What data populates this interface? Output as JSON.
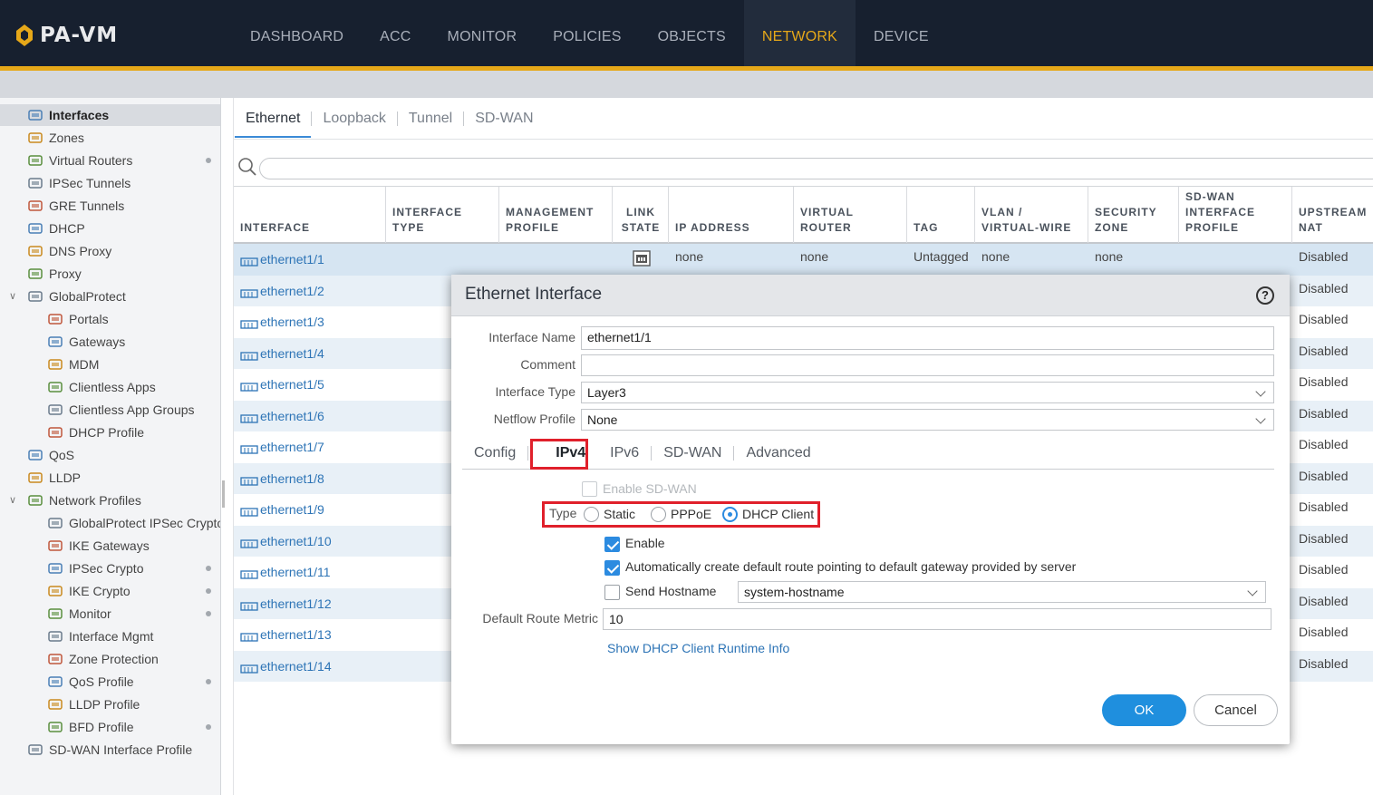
{
  "app": {
    "logo_text": "PA-VM"
  },
  "nav": [
    "DASHBOARD",
    "ACC",
    "MONITOR",
    "POLICIES",
    "OBJECTS",
    "NETWORK",
    "DEVICE"
  ],
  "nav_active": "NETWORK",
  "sidebar": [
    {
      "label": "Interfaces",
      "icon": "interfaces-icon",
      "active": true
    },
    {
      "label": "Zones",
      "icon": "zones-icon"
    },
    {
      "label": "Virtual Routers",
      "icon": "virtual-router-icon",
      "dot": true
    },
    {
      "label": "IPSec Tunnels",
      "icon": "ipsec-tunnel-icon"
    },
    {
      "label": "GRE Tunnels",
      "icon": "gre-tunnel-icon"
    },
    {
      "label": "DHCP",
      "icon": "dhcp-icon"
    },
    {
      "label": "DNS Proxy",
      "icon": "dns-proxy-icon"
    },
    {
      "label": "Proxy",
      "icon": "proxy-icon"
    },
    {
      "label": "GlobalProtect",
      "icon": "globalprotect-icon",
      "expandable": true
    },
    {
      "label": "Portals",
      "icon": "portals-icon",
      "indent": true
    },
    {
      "label": "Gateways",
      "icon": "gateways-icon",
      "indent": true
    },
    {
      "label": "MDM",
      "icon": "mdm-icon",
      "indent": true
    },
    {
      "label": "Clientless Apps",
      "icon": "clientless-apps-icon",
      "indent": true
    },
    {
      "label": "Clientless App Groups",
      "icon": "clientless-app-groups-icon",
      "indent": true
    },
    {
      "label": "DHCP Profile",
      "icon": "dhcp-profile-icon",
      "indent": true
    },
    {
      "label": "QoS",
      "icon": "qos-icon"
    },
    {
      "label": "LLDP",
      "icon": "lldp-icon"
    },
    {
      "label": "Network Profiles",
      "icon": "network-profiles-icon",
      "expandable": true
    },
    {
      "label": "GlobalProtect IPSec Crypto",
      "icon": "lock-icon",
      "indent": true
    },
    {
      "label": "IKE Gateways",
      "icon": "ike-gateways-icon",
      "indent": true
    },
    {
      "label": "IPSec Crypto",
      "icon": "lock-icon",
      "indent": true,
      "dot": true
    },
    {
      "label": "IKE Crypto",
      "icon": "lock-icon",
      "indent": true,
      "dot": true
    },
    {
      "label": "Monitor",
      "icon": "monitor-icon",
      "indent": true,
      "dot": true
    },
    {
      "label": "Interface Mgmt",
      "icon": "interface-mgmt-icon",
      "indent": true
    },
    {
      "label": "Zone Protection",
      "icon": "zone-protection-icon",
      "indent": true
    },
    {
      "label": "QoS Profile",
      "icon": "qos-profile-icon",
      "indent": true,
      "dot": true
    },
    {
      "label": "LLDP Profile",
      "icon": "lldp-profile-icon",
      "indent": true
    },
    {
      "label": "BFD Profile",
      "icon": "bfd-profile-icon",
      "indent": true,
      "dot": true
    },
    {
      "label": "SD-WAN Interface Profile",
      "icon": "sdwan-interface-profile-icon"
    }
  ],
  "tabs": [
    "Ethernet",
    "Loopback",
    "Tunnel",
    "SD-WAN"
  ],
  "tabs_active": "Ethernet",
  "table": {
    "headers": [
      "INTERFACE",
      "INTERFACE TYPE",
      "MANAGEMENT PROFILE",
      "LINK STATE",
      "IP ADDRESS",
      "VIRTUAL ROUTER",
      "TAG",
      "VLAN / VIRTUAL-WIRE",
      "SECURITY ZONE",
      "SD-WAN INTERFACE PROFILE",
      "UPSTREAM NAT"
    ],
    "rows": [
      {
        "interface": "ethernet1/1",
        "ip": "none",
        "vr": "none",
        "tag": "Untagged",
        "vlan": "none",
        "zone": "none",
        "nat": "Disabled",
        "link_icon": true
      },
      {
        "interface": "ethernet1/2",
        "nat": "Disabled"
      },
      {
        "interface": "ethernet1/3",
        "nat": "Disabled"
      },
      {
        "interface": "ethernet1/4",
        "nat": "Disabled"
      },
      {
        "interface": "ethernet1/5",
        "nat": "Disabled"
      },
      {
        "interface": "ethernet1/6",
        "nat": "Disabled"
      },
      {
        "interface": "ethernet1/7",
        "nat": "Disabled"
      },
      {
        "interface": "ethernet1/8",
        "nat": "Disabled"
      },
      {
        "interface": "ethernet1/9",
        "nat": "Disabled"
      },
      {
        "interface": "ethernet1/10",
        "nat": "Disabled"
      },
      {
        "interface": "ethernet1/11",
        "nat": "Disabled"
      },
      {
        "interface": "ethernet1/12",
        "nat": "Disabled"
      },
      {
        "interface": "ethernet1/13",
        "nat": "Disabled"
      },
      {
        "interface": "ethernet1/14",
        "nat": "Disabled"
      }
    ]
  },
  "modal": {
    "title": "Ethernet Interface",
    "help": "?",
    "fields": {
      "interface_name_label": "Interface Name",
      "interface_name_value": "ethernet1/1",
      "comment_label": "Comment",
      "comment_value": "",
      "interface_type_label": "Interface Type",
      "interface_type_value": "Layer3",
      "netflow_label": "Netflow Profile",
      "netflow_value": "None"
    },
    "tabs": [
      "Config",
      "IPv4",
      "IPv6",
      "SD-WAN",
      "Advanced"
    ],
    "tabs_active": "IPv4",
    "enable_sdwan_label": "Enable SD-WAN",
    "type_label": "Type",
    "type_options": [
      "Static",
      "PPPoE",
      "DHCP Client"
    ],
    "type_selected": "DHCP Client",
    "enable_label": "Enable",
    "enable_checked": true,
    "auto_route_label": "Automatically create default route pointing to default gateway provided by server",
    "auto_route_checked": true,
    "send_hostname_label": "Send Hostname",
    "send_hostname_checked": false,
    "hostname_value": "system-hostname",
    "metric_label": "Default Route Metric",
    "metric_value": "10",
    "runtime_link": "Show DHCP Client Runtime Info",
    "ok_label": "OK",
    "cancel_label": "Cancel"
  },
  "colors": {
    "accent": "#e6a819",
    "link": "#2d74b6",
    "primary_button": "#1f8fde",
    "highlight": "#e0202b"
  }
}
